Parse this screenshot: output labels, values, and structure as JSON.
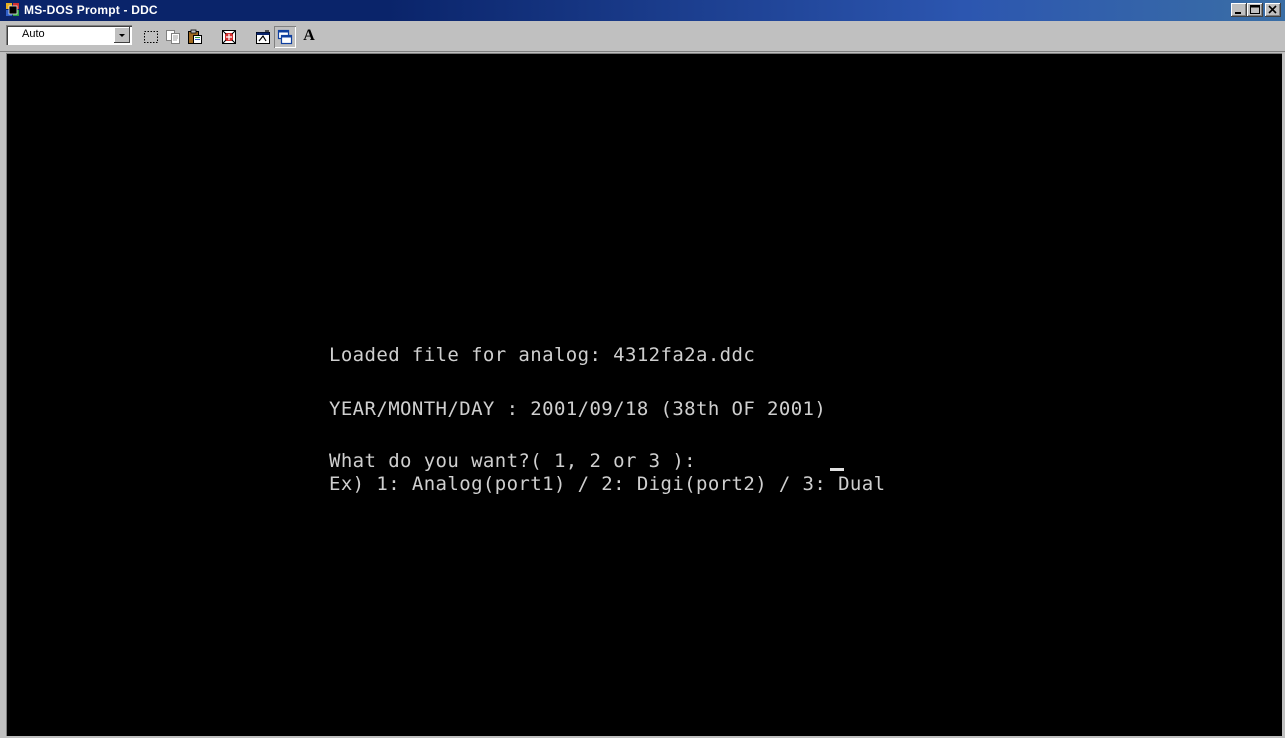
{
  "window": {
    "title": "MS-DOS Prompt - DDC",
    "controls": [
      "minimize-icon",
      "maximize-icon",
      "close-icon"
    ]
  },
  "toolbar": {
    "font_size_value": "Auto",
    "buttons": [
      "mark-icon",
      "copy-icon",
      "paste-icon",
      "full-screen-icon",
      "properties-icon",
      "background-icon",
      "font-icon"
    ],
    "font_button_label": "A"
  },
  "console": {
    "lines": [
      "Loaded file for analog: 4312fa2a.ddc",
      "YEAR/MONTH/DAY : 2001/09/18 (38th OF 2001)",
      "What do you want?( 1, 2 or 3 ): ",
      "Ex) 1: Analog(port1) / 2: Digi(port2) / 3: Dual"
    ],
    "colors": {
      "background": "#000000",
      "text": "#cfcfcf"
    }
  },
  "colors": {
    "titlebar_start": "#0a246a",
    "titlebar_end": "#3a6ea5",
    "chrome": "#c0c0c0"
  }
}
